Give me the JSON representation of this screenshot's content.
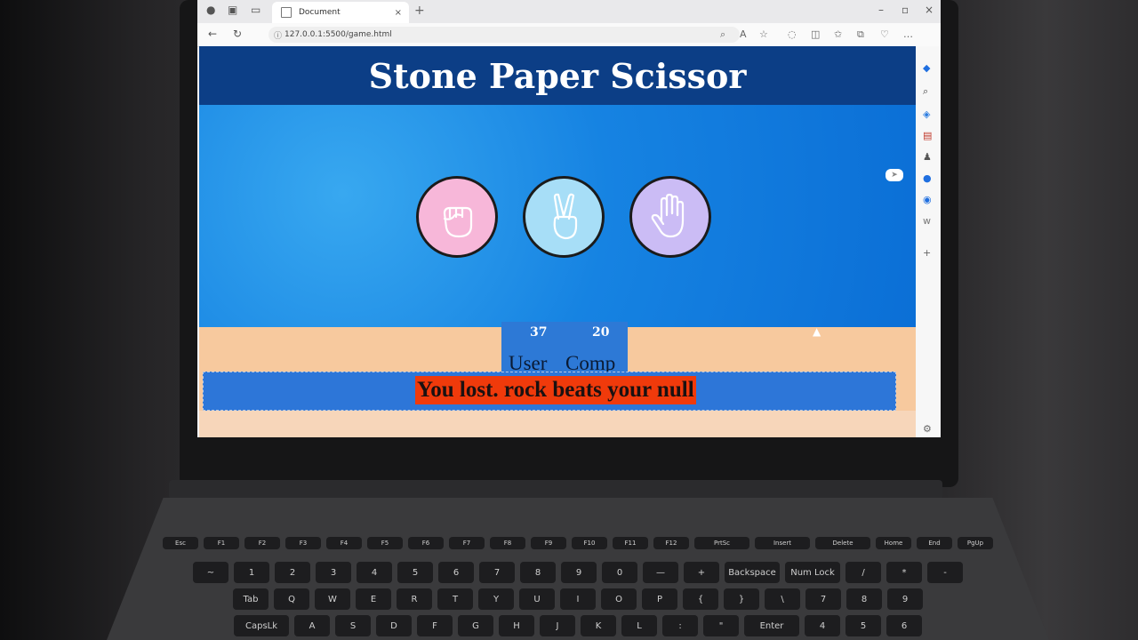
{
  "browser": {
    "tab_title": "Document",
    "url": "127.0.0.1:5500/game.html",
    "new_tab_symbol": "+",
    "close_symbol": "×"
  },
  "game": {
    "title": "Stone Paper Scissor",
    "choices": [
      {
        "name": "rock",
        "color": "#f7b7d9"
      },
      {
        "name": "scissors",
        "color": "#a7def7"
      },
      {
        "name": "paper",
        "color": "#cbbcf5"
      }
    ],
    "score": {
      "user_score": "37",
      "comp_score": "20",
      "user_label": "User",
      "comp_label": "Comp"
    },
    "message": "You lost. rock beats your null",
    "message_bg": "#f03a0b"
  },
  "keyboard": {
    "row1": [
      "Esc",
      "F1",
      "F2",
      "F3",
      "F4",
      "F5",
      "F6",
      "F7",
      "F8",
      "F9",
      "F10",
      "F11",
      "F12",
      "PrtSc",
      "Insert",
      "Delete",
      "Home",
      "End",
      "PgUp"
    ],
    "row2": [
      "~",
      "1",
      "2",
      "3",
      "4",
      "5",
      "6",
      "7",
      "8",
      "9",
      "0",
      "—",
      "+",
      "Backspace",
      "Num Lock",
      "/",
      "*",
      "-"
    ],
    "row3": [
      "Tab",
      "Q",
      "W",
      "E",
      "R",
      "T",
      "Y",
      "U",
      "I",
      "O",
      "P",
      "{",
      "}",
      "\\",
      "7",
      "8",
      "9"
    ],
    "row4": [
      "CapsLk",
      "A",
      "S",
      "D",
      "F",
      "G",
      "H",
      "J",
      "K",
      "L",
      ":",
      "\"",
      "Enter",
      "4",
      "5",
      "6"
    ]
  }
}
